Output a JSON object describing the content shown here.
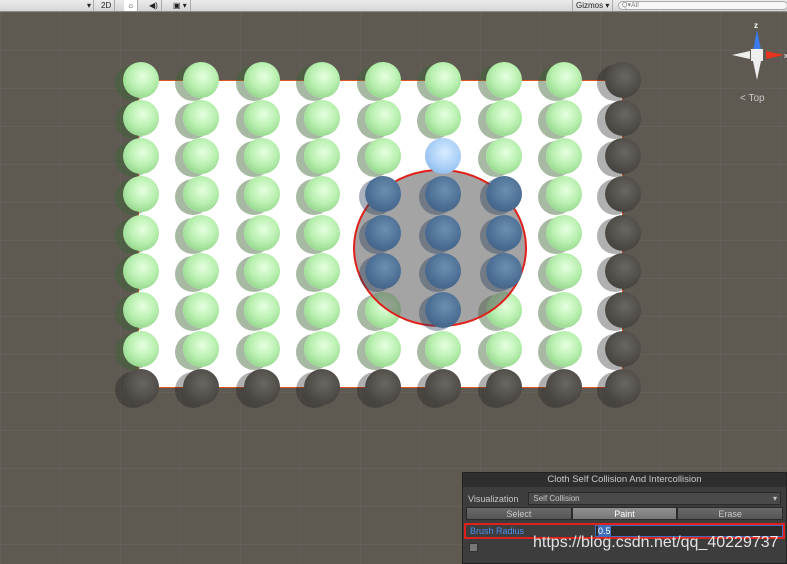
{
  "toolbar": {
    "mode_2d": "2D",
    "lighting_icon": "sun-icon",
    "audio_icon": "speaker-icon",
    "effects_icon": "image-icon",
    "gizmos": "Gizmos",
    "search_placeholder": "All"
  },
  "gizmo": {
    "z_label": "z",
    "x_label": "x",
    "view_label": "Top"
  },
  "particles": [
    [
      "g",
      "g",
      "g",
      "g",
      "g",
      "g",
      "g",
      "g",
      "d"
    ],
    [
      "g",
      "g",
      "g",
      "g",
      "g",
      "g",
      "g",
      "g",
      "d"
    ],
    [
      "g",
      "g",
      "g",
      "g",
      "g",
      "l",
      "g",
      "g",
      "d"
    ],
    [
      "g",
      "g",
      "g",
      "g",
      "b",
      "b",
      "b",
      "g",
      "d"
    ],
    [
      "g",
      "g",
      "g",
      "g",
      "b",
      "b",
      "b",
      "g",
      "d"
    ],
    [
      "g",
      "g",
      "g",
      "g",
      "b",
      "b",
      "b",
      "g",
      "d"
    ],
    [
      "g",
      "g",
      "g",
      "g",
      "g",
      "b",
      "g",
      "g",
      "d"
    ],
    [
      "g",
      "g",
      "g",
      "g",
      "g",
      "g",
      "g",
      "g",
      "d"
    ],
    [
      "d",
      "d",
      "d",
      "d",
      "d",
      "d",
      "d",
      "d",
      "d"
    ]
  ],
  "panel": {
    "title": "Cloth Self Collision And Intercollision",
    "visualization_label": "Visualization",
    "visualization_value": "Self Collision",
    "tabs": [
      "Select",
      "Paint",
      "Erase"
    ],
    "active_tab": "Paint",
    "brush_radius_label": "Brush Radius",
    "brush_radius_value": "0.5"
  },
  "watermark": "https://blog.csdn.net/qq_40229737"
}
